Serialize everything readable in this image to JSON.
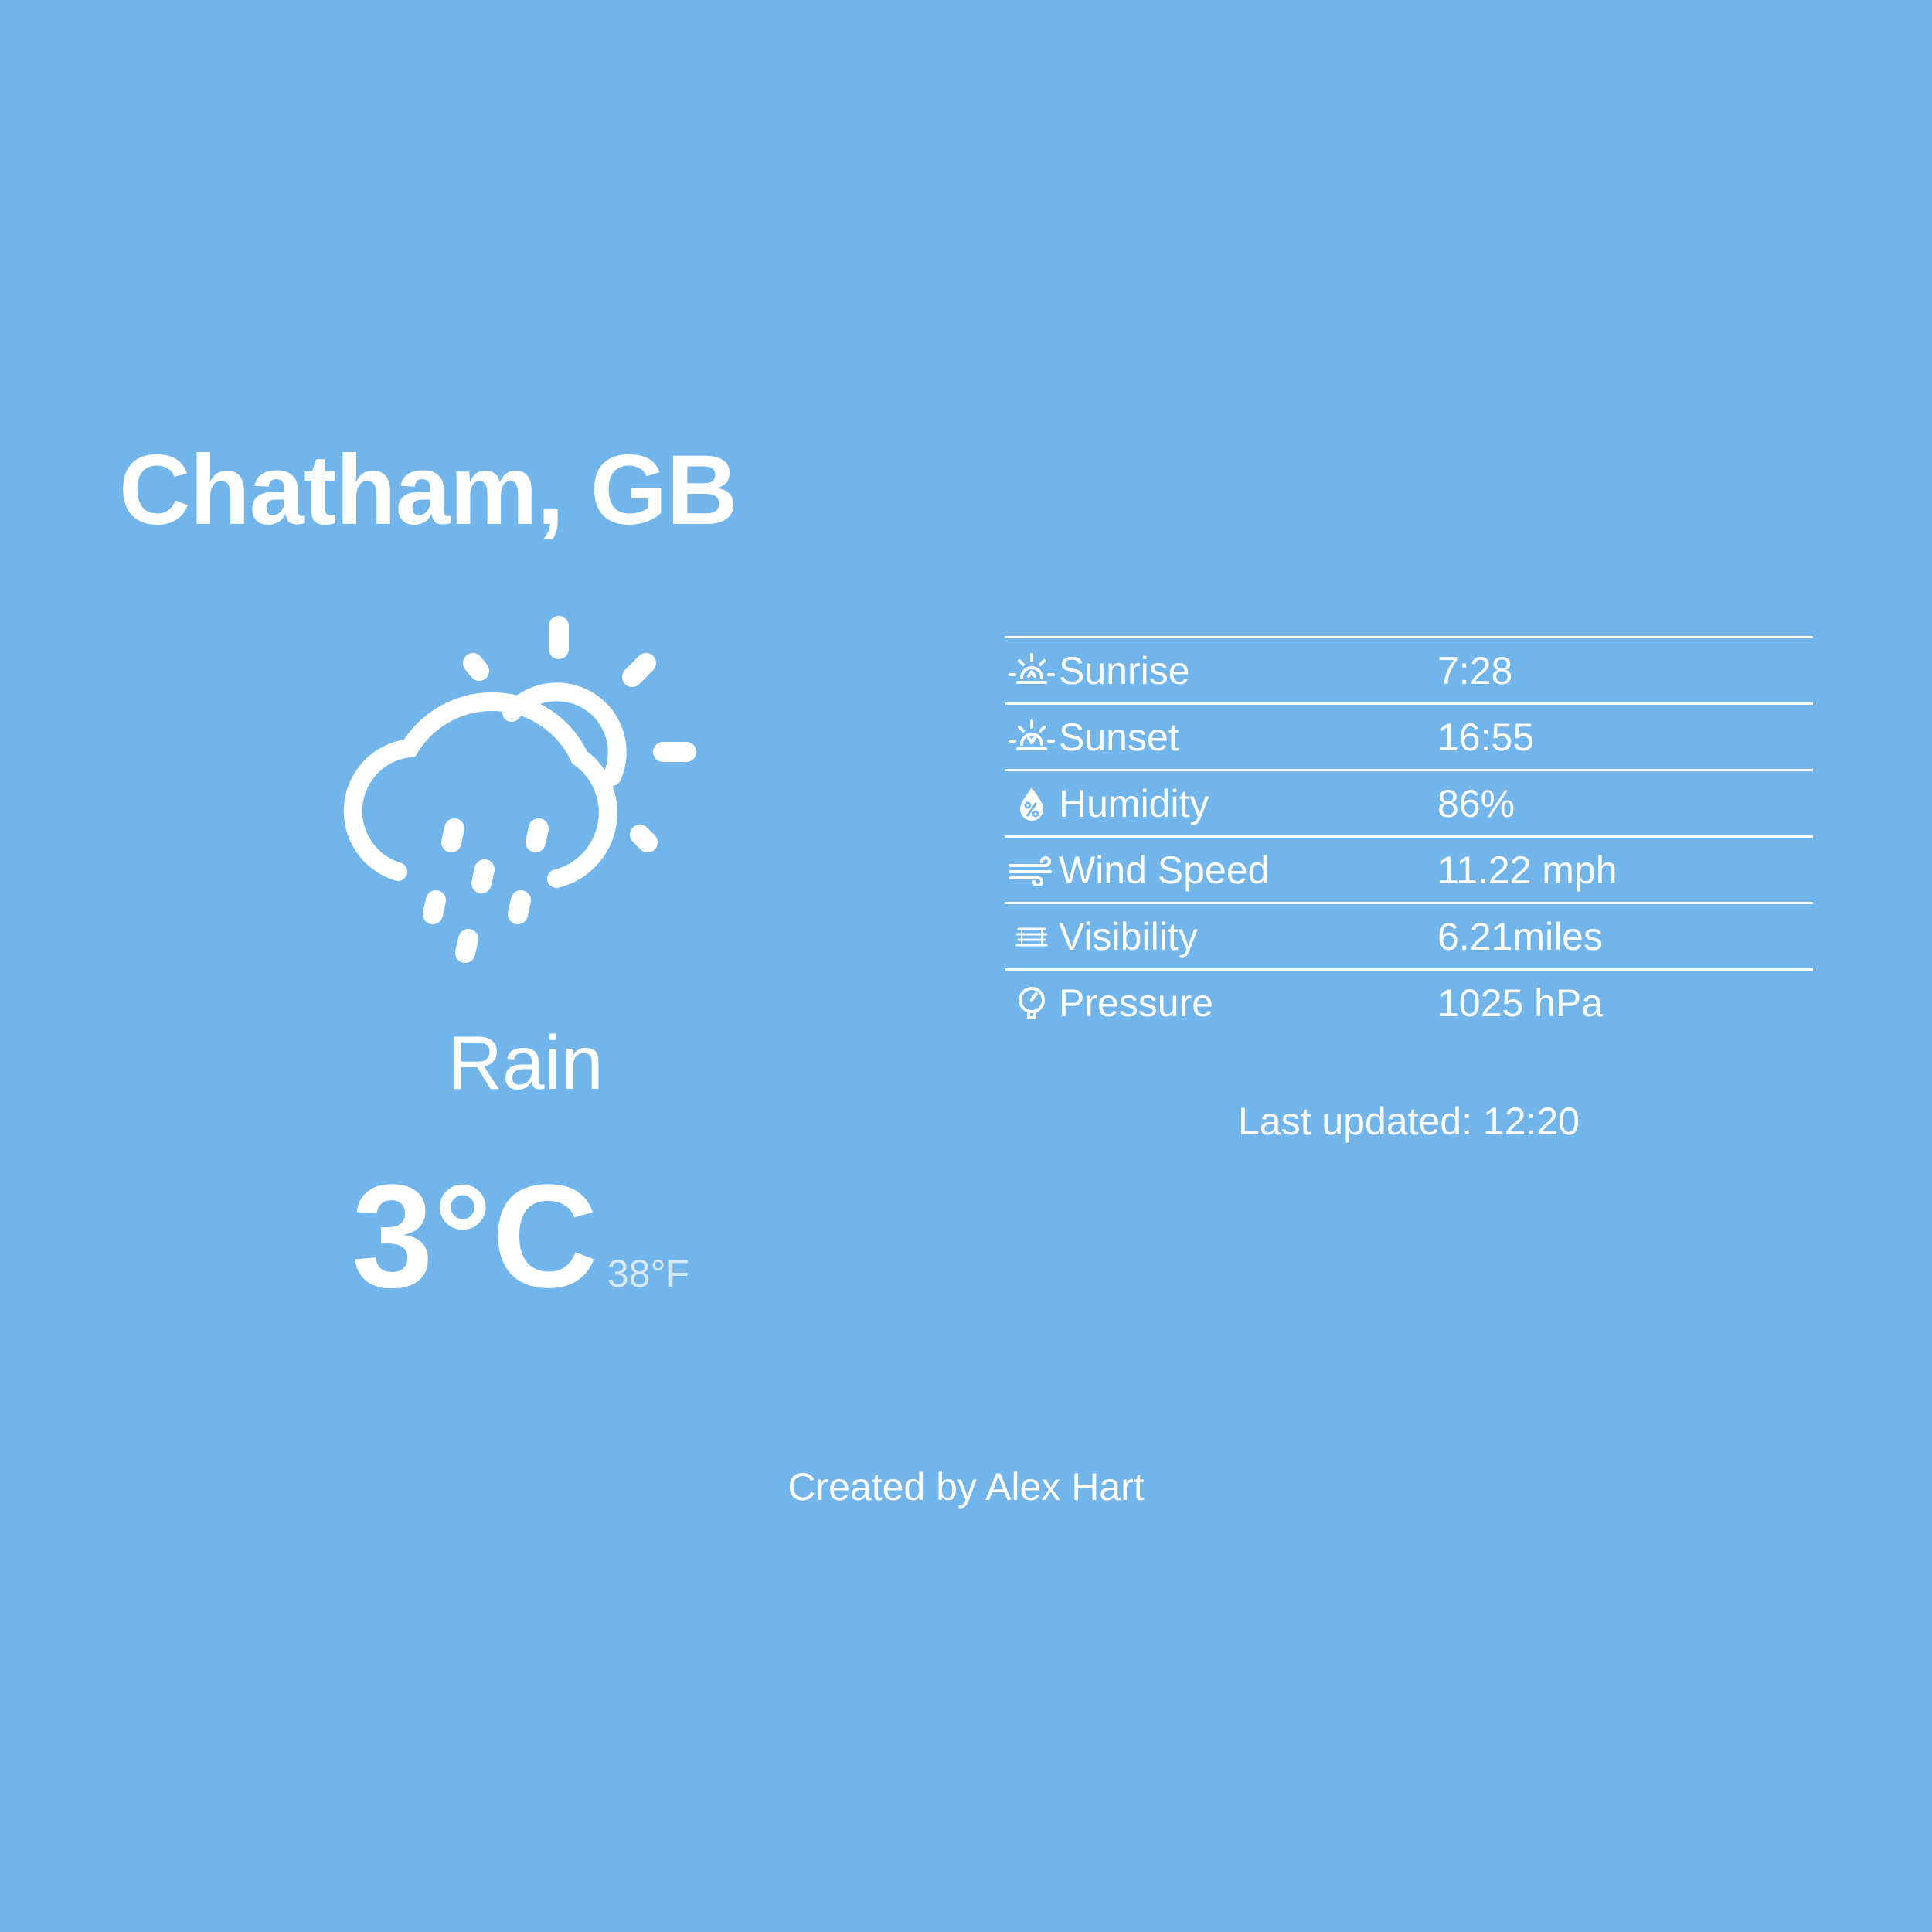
{
  "location": "Chatham, GB",
  "current": {
    "icon": "rain-partly-sunny-icon",
    "condition": "Rain",
    "temp_c": "3°C",
    "temp_f": "38°F"
  },
  "details": [
    {
      "icon": "sunrise-icon",
      "label": "Sunrise",
      "value": "7:28"
    },
    {
      "icon": "sunset-icon",
      "label": "Sunset",
      "value": "16:55"
    },
    {
      "icon": "humidity-icon",
      "label": "Humidity",
      "value": "86%"
    },
    {
      "icon": "wind-icon",
      "label": "Wind Speed",
      "value": "11.22 mph"
    },
    {
      "icon": "visibility-icon",
      "label": "Visibility",
      "value": "6.21miles"
    },
    {
      "icon": "pressure-icon",
      "label": "Pressure",
      "value": "1025 hPa"
    }
  ],
  "last_updated": "Last updated: 12:20",
  "footer": "Created by Alex Hart",
  "colors": {
    "background": "#72b5eb",
    "text": "#ffffff",
    "secondary_text": "#d9e9f8"
  }
}
